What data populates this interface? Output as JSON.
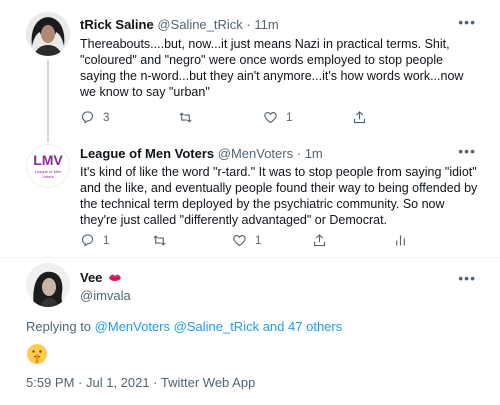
{
  "tweets": [
    {
      "name": "tRick Saline",
      "handle": "@Saline_tRick",
      "separator": "·",
      "time": "11m",
      "text": "Thereabouts....but, now...it just means Nazi in practical terms.  Shit, \"coloured\" and \"negro\" were once words employed to stop people saying the n-word...but they ain't anymore...it's how words work...now we know to say \"urban\"",
      "reply_count": "3",
      "retweet_count": "",
      "like_count": "1"
    },
    {
      "name": "League of Men Voters",
      "handle": "@MenVoters",
      "separator": "·",
      "time": "1m",
      "avatar_text": "LMV",
      "avatar_subtext": "League of Men Voters",
      "text": "It's kind of like the word \"r-tard.\"  It was to stop people from saying \"idiot\" and the like, and eventually people found their way to being offended by the technical term deployed by the psychiatric community.  So now they're just called \"differently advantaged\" or Democrat.",
      "reply_count": "1",
      "retweet_count": "",
      "like_count": "1"
    }
  ],
  "main_tweet": {
    "name": "Vee",
    "handle": "@imvala",
    "name_emoji": "lips-icon",
    "replying_prefix": "Replying to",
    "replying_users": "@MenVoters @Saline_tRick",
    "replying_and": "and",
    "replying_others": "47 others",
    "content_emoji": "shushing-face-icon",
    "timestamp": "5:59 PM · Jul 1, 2021 · Twitter Web App"
  },
  "colors": {
    "link": "#1d9bf0",
    "muted": "#536471",
    "lmv_purple": "#8b2c8f",
    "lips": "#e0245e"
  }
}
